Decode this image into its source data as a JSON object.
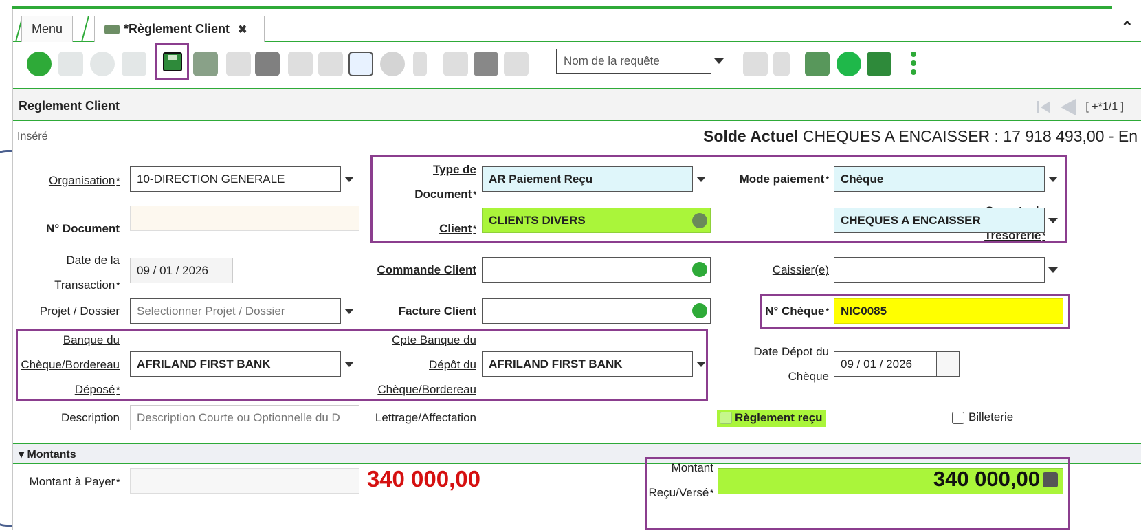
{
  "tabs": {
    "menu": "Menu",
    "active": "*Règlement Client",
    "close": "✖",
    "collapse": "⌃"
  },
  "toolbar": {
    "query_placeholder": "Nom de la requête"
  },
  "section": {
    "title": "Reglement Client",
    "nav_record": "[ +*1/1 ]"
  },
  "status": {
    "inserted": "Inséré",
    "solde_label": "Solde Actuel",
    "solde_value": "CHEQUES A ENCAISSER : 17 918 493,00 - En"
  },
  "form": {
    "organisation": {
      "label": "Organisation",
      "value": "10-DIRECTION GENERALE"
    },
    "type_document": {
      "label1": "Type de",
      "label2": "Document",
      "value": "AR Paiement Reçu"
    },
    "mode_paiement": {
      "label": "Mode paiement",
      "value": "Chèque"
    },
    "n_document": {
      "label": "N° Document",
      "value": ""
    },
    "client": {
      "label": "Client",
      "value": "CLIENTS DIVERS"
    },
    "compte_tresorerie": {
      "label1": "Compte de",
      "label2": "Trésorerie",
      "value": "CHEQUES A ENCAISSER"
    },
    "date_transaction": {
      "label1": "Date de la",
      "label2": "Transaction",
      "value": "09 / 01 / 2026"
    },
    "commande_client": {
      "label": "Commande Client",
      "value": ""
    },
    "caissier": {
      "label": "Caissier(e)",
      "value": ""
    },
    "projet": {
      "label": "Projet / Dossier",
      "placeholder": "Selectionner Projet / Dossier"
    },
    "facture_client": {
      "label": "Facture Client",
      "value": ""
    },
    "n_cheque": {
      "label": "N° Chèque",
      "value": "NIC0085"
    },
    "banque_cheque": {
      "label1": "Banque du",
      "label2": "Chèque/Bordereau",
      "label3": "Déposé",
      "value": "AFRILAND FIRST BANK"
    },
    "cpte_banque_depot": {
      "label1": "Cpte Banque du",
      "label2": "Dépôt du",
      "label3": "Chèque/Bordereau",
      "value": "AFRILAND FIRST BANK"
    },
    "date_depot": {
      "label1": "Date Dépot du",
      "label2": "Chèque",
      "value": "09 / 01 / 2026"
    },
    "description": {
      "label": "Description",
      "placeholder": "Description Courte ou Optionnelle du D"
    },
    "lettrage": {
      "label": "Lettrage/Affectation"
    },
    "reglement_recu": {
      "label": "Règlement reçu",
      "checked": false
    },
    "billeterie": {
      "label": "Billeterie",
      "checked": false
    }
  },
  "montants": {
    "title": "Montants",
    "montant_payer": {
      "label": "Montant à Payer",
      "value": "340 000,00"
    },
    "montant_recu": {
      "label1": "Montant",
      "label2": "Reçu/Versé",
      "value": "340 000,00"
    }
  },
  "colors": {
    "accent": "#2eaa38",
    "highlight_border": "#8b3e8e",
    "lime": "#aaf53a",
    "cyan": "#dff6fa",
    "red": "#d51010"
  }
}
